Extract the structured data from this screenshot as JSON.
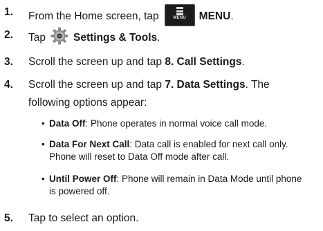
{
  "steps": [
    {
      "num": "1.",
      "pre": "From the Home screen, tap",
      "icon_label": "MENU",
      "bold": "MENU",
      "post": "."
    },
    {
      "num": "2.",
      "pre": "Tap",
      "bold": "Settings & Tools",
      "post": "."
    },
    {
      "num": "3.",
      "pre": "Scroll the screen up and tap ",
      "bold": "8. Call Settings",
      "post": "."
    },
    {
      "num": "4.",
      "pre": "Scroll the screen up and tap ",
      "bold": "7. Data Settings",
      "post": ". The",
      "line2": "following options appear:"
    },
    {
      "num": "5.",
      "text": "Tap to select an option."
    }
  ],
  "options": [
    {
      "term": "Data Off",
      "desc": ": Phone operates in normal voice call mode."
    },
    {
      "term": "Data For Next Call",
      "desc": ": Data call is enabled for next call only. Phone will reset to Data Off mode after call."
    },
    {
      "term": "Until Power Off",
      "desc": ": Phone will remain in Data Mode until phone is powered off."
    }
  ],
  "icons": [
    "menu-icon",
    "settings-gear-icon"
  ]
}
